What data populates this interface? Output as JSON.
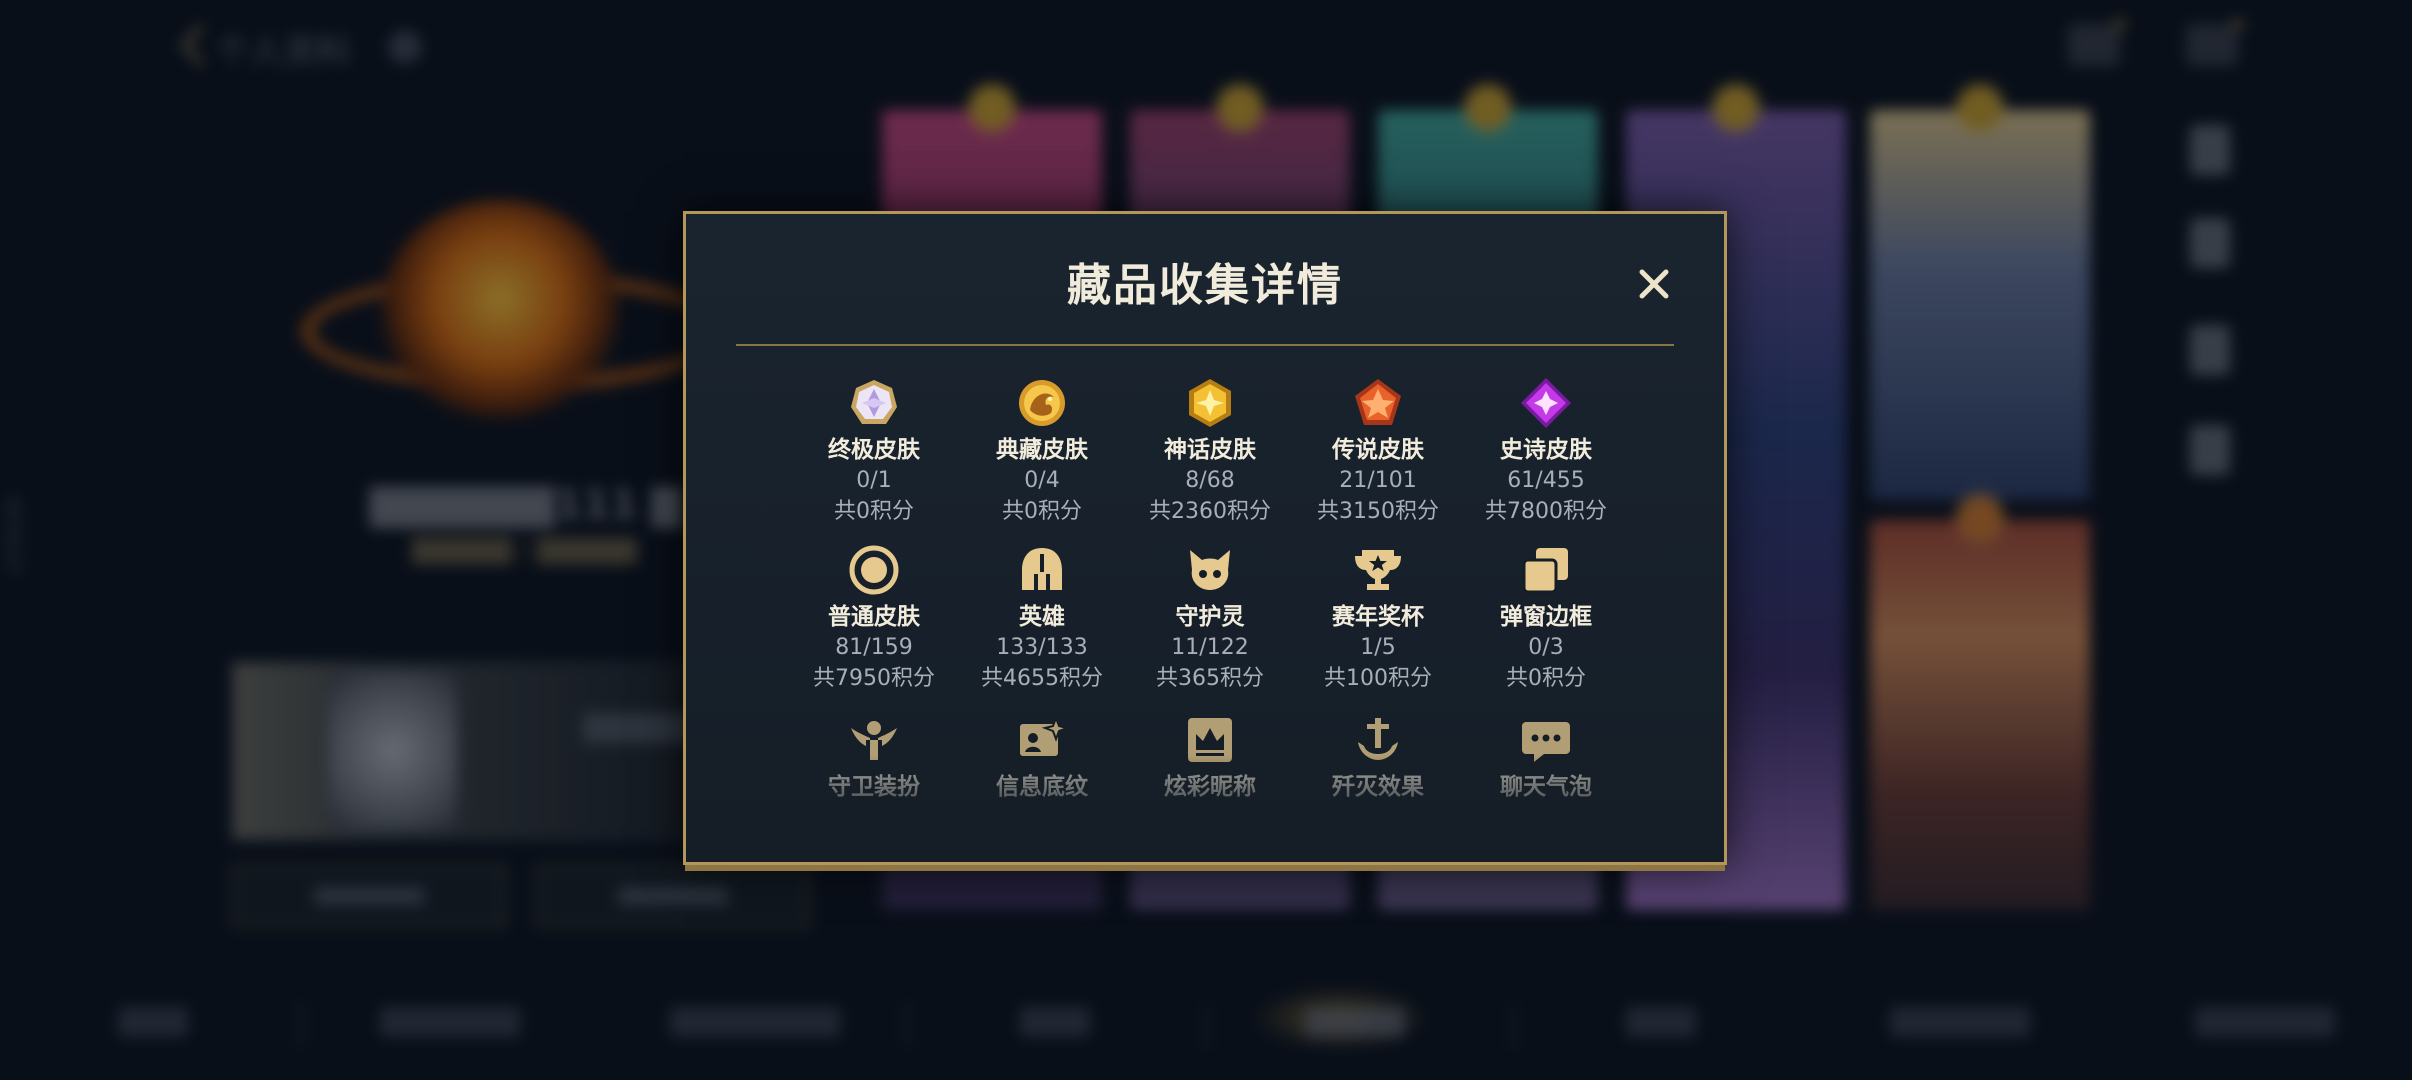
{
  "background": {
    "profile_title": "个人资料",
    "uid": "3879237"
  },
  "dialog": {
    "title": "藏品收集详情",
    "close_icon": "close-icon",
    "items": [
      {
        "icon": "ultimate-skin-icon",
        "name": "终极皮肤",
        "count": "0/1",
        "points": "共0积分"
      },
      {
        "icon": "collection-skin-icon",
        "name": "典藏皮肤",
        "count": "0/4",
        "points": "共0积分"
      },
      {
        "icon": "myth-skin-icon",
        "name": "神话皮肤",
        "count": "8/68",
        "points": "共2360积分"
      },
      {
        "icon": "legend-skin-icon",
        "name": "传说皮肤",
        "count": "21/101",
        "points": "共3150积分"
      },
      {
        "icon": "epic-skin-icon",
        "name": "史诗皮肤",
        "count": "61/455",
        "points": "共7800积分"
      },
      {
        "icon": "normal-skin-icon",
        "name": "普通皮肤",
        "count": "81/159",
        "points": "共7950积分"
      },
      {
        "icon": "hero-helmet-icon",
        "name": "英雄",
        "count": "133/133",
        "points": "共4655积分"
      },
      {
        "icon": "guardian-spirit-icon",
        "name": "守护灵",
        "count": "11/122",
        "points": "共365积分"
      },
      {
        "icon": "season-trophy-icon",
        "name": "赛年奖杯",
        "count": "1/5",
        "points": "共100积分"
      },
      {
        "icon": "popup-frame-icon",
        "name": "弹窗边框",
        "count": "0/3",
        "points": "共0积分"
      },
      {
        "icon": "guard-outfit-icon",
        "name": "守卫装扮"
      },
      {
        "icon": "info-background-icon",
        "name": "信息底纹"
      },
      {
        "icon": "colorful-nickname-icon",
        "name": "炫彩昵称"
      },
      {
        "icon": "elimination-effect-icon",
        "name": "歼灭效果"
      },
      {
        "icon": "chat-bubble-icon",
        "name": "聊天气泡"
      }
    ]
  },
  "colors": {
    "dialog_border": "#b39659",
    "title_text": "#f1ebdb",
    "sub_text": "#a9aeb8",
    "icon_gold": "#e6c98e"
  }
}
